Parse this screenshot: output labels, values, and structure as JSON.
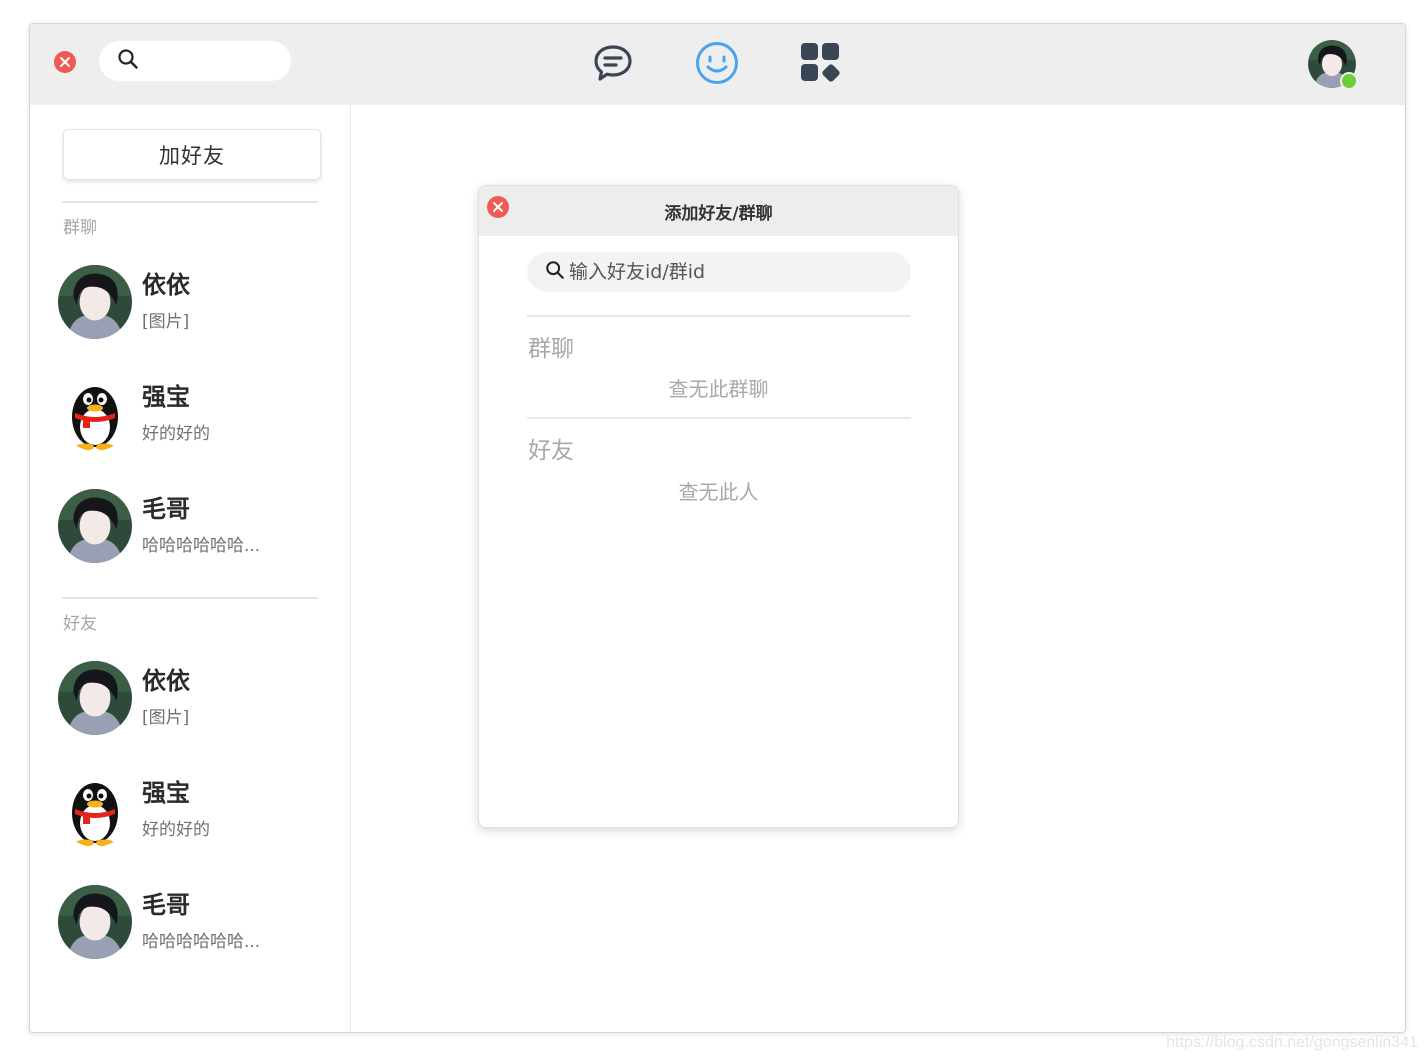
{
  "topbar": {
    "search_placeholder": "",
    "icons": {
      "close": "close-icon",
      "search": "search-icon",
      "chat": "chat-bubble-icon",
      "contacts": "smiley-icon",
      "apps": "apps-grid-icon"
    },
    "active_tab": "contacts",
    "active_color": "#4aa3ee",
    "user_status": "online"
  },
  "sidebar": {
    "add_friend_label": "加好友",
    "groups_label": "群聊",
    "friends_label": "好友",
    "groups": [
      {
        "name": "依依",
        "last_message": "[图片]",
        "avatar": "anime-boy-avatar"
      },
      {
        "name": "强宝",
        "last_message": "好的好的",
        "avatar": "qq-penguin-avatar"
      },
      {
        "name": "毛哥",
        "last_message": "哈哈哈哈哈哈...",
        "avatar": "anime-boy-avatar"
      }
    ],
    "friends": [
      {
        "name": "依依",
        "last_message": "[图片]",
        "avatar": "anime-boy-avatar"
      },
      {
        "name": "强宝",
        "last_message": "好的好的",
        "avatar": "qq-penguin-avatar"
      },
      {
        "name": "毛哥",
        "last_message": "哈哈哈哈哈哈...",
        "avatar": "anime-boy-avatar"
      }
    ]
  },
  "dialog": {
    "title": "添加好友/群聊",
    "search_placeholder": "输入好友id/群id",
    "groups_label": "群聊",
    "groups_empty": "查无此群聊",
    "friends_label": "好友",
    "friends_empty": "查无此人"
  },
  "watermark": "https://blog.csdn.net/gongsenlin341",
  "colors": {
    "close_red": "#ec5c52",
    "online_green": "#6cce3a",
    "topbar_bg": "#eeeeee",
    "nav_icon_dark": "#3a4555"
  }
}
